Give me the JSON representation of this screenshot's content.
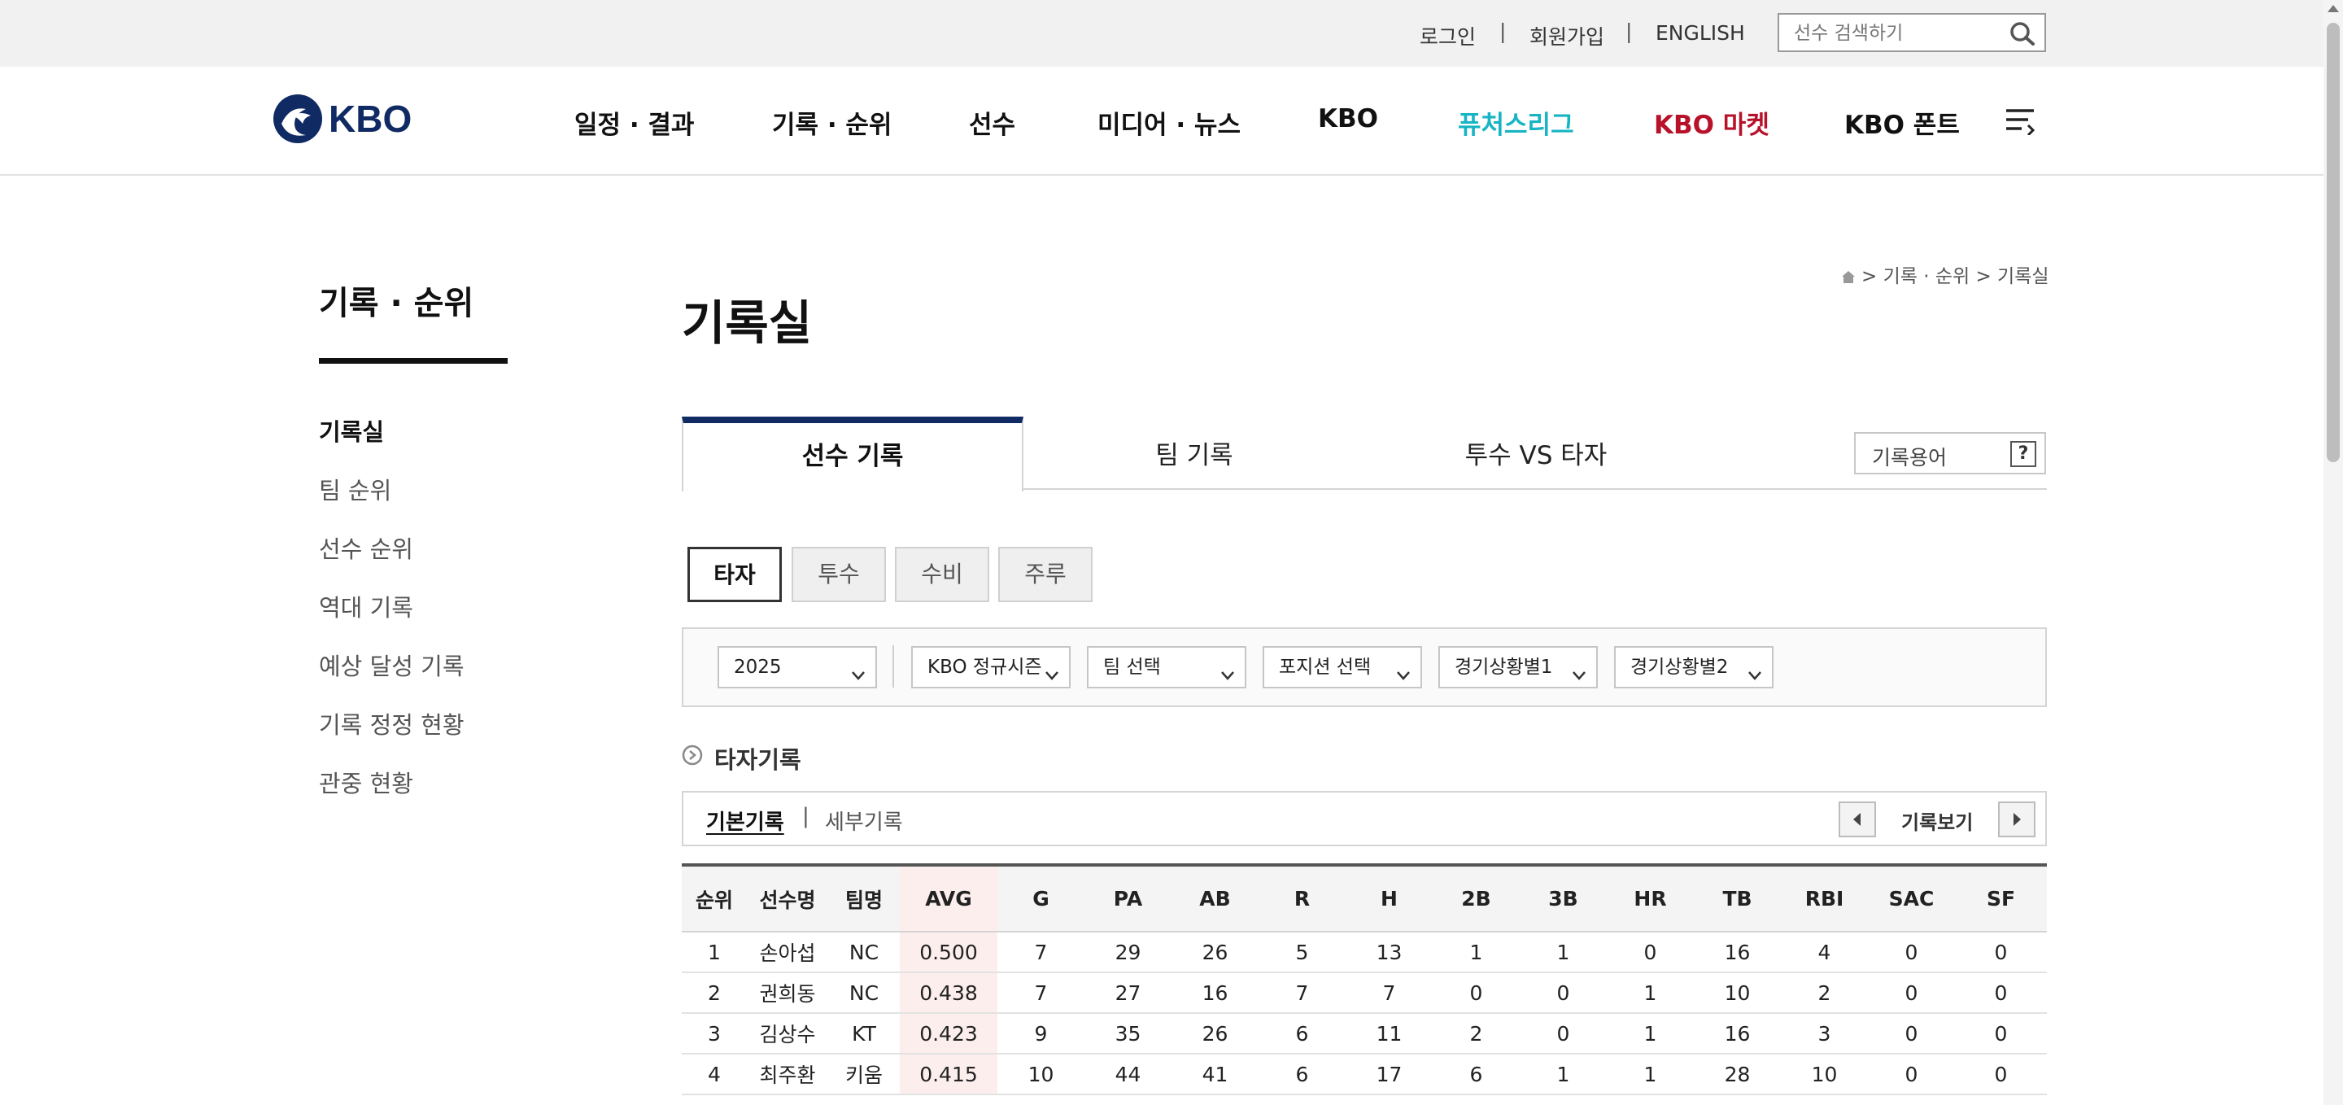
{
  "utility": {
    "login": "로그인",
    "signup": "회원가입",
    "english": "ENGLISH",
    "separator": "|",
    "search_placeholder": "선수 검색하기"
  },
  "nav": {
    "logo_text": "KBO",
    "items": [
      "일정 · 결과",
      "기록 · 순위",
      "선수",
      "미디어 · 뉴스",
      "KBO",
      "퓨처스리그",
      "KBO 마켓",
      "KBO 폰트"
    ],
    "colors": {
      "futures": "#17b4c4",
      "market": "#b8122b",
      "logo": "#102a63"
    }
  },
  "sidebar": {
    "title": "기록 · 순위",
    "items": [
      "기록실",
      "팀 순위",
      "선수 순위",
      "역대 기록",
      "예상 달성 기록",
      "기록 정정 현황",
      "관중 현황"
    ],
    "active_index": 0
  },
  "breadcrumb": "> 기록 · 순위 > 기록실",
  "page_title": "기록실",
  "tabs": [
    "선수 기록",
    "팀 기록",
    "투수 VS 타자"
  ],
  "glossary": {
    "label": "기록용어",
    "icon": "?"
  },
  "subtabs": [
    "타자",
    "투수",
    "수비",
    "주루"
  ],
  "filters": [
    "2025",
    "KBO 정규시즌",
    "팀 선택",
    "포지션 선택",
    "경기상황별1",
    "경기상황별2"
  ],
  "section_title": "타자기록",
  "record_bar": {
    "basic": "기본기록",
    "sep": "|",
    "detail": "세부기록",
    "view": "기록보기"
  },
  "table": {
    "headers": [
      "순위",
      "선수명",
      "팀명",
      "AVG",
      "G",
      "PA",
      "AB",
      "R",
      "H",
      "2B",
      "3B",
      "HR",
      "TB",
      "RBI",
      "SAC",
      "SF"
    ],
    "rows": [
      [
        "1",
        "손아섭",
        "NC",
        "0.500",
        "7",
        "29",
        "26",
        "5",
        "13",
        "1",
        "1",
        "0",
        "16",
        "4",
        "0",
        "0"
      ],
      [
        "2",
        "권희동",
        "NC",
        "0.438",
        "7",
        "27",
        "16",
        "7",
        "7",
        "0",
        "0",
        "1",
        "10",
        "2",
        "0",
        "0"
      ],
      [
        "3",
        "김상수",
        "KT",
        "0.423",
        "9",
        "35",
        "26",
        "6",
        "11",
        "2",
        "0",
        "1",
        "16",
        "3",
        "0",
        "0"
      ],
      [
        "4",
        "최주환",
        "키움",
        "0.415",
        "10",
        "44",
        "41",
        "6",
        "17",
        "6",
        "1",
        "1",
        "28",
        "10",
        "0",
        "0"
      ]
    ]
  }
}
